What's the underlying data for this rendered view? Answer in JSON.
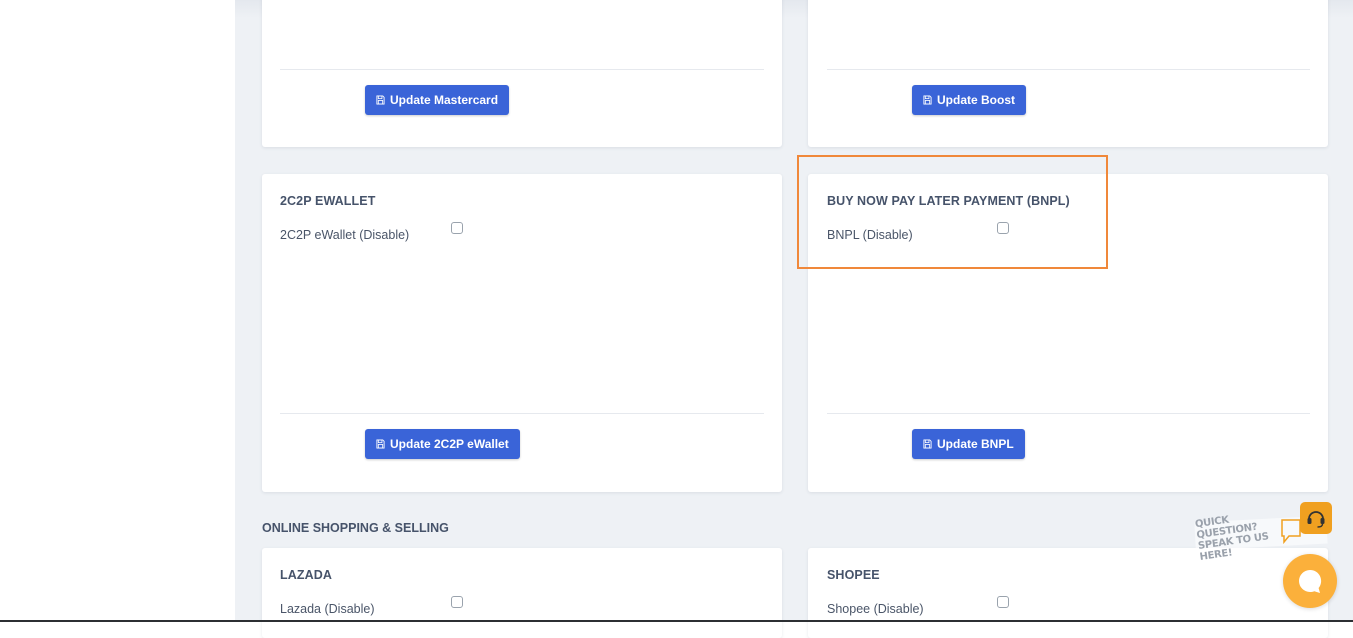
{
  "cards": {
    "mastercard": {
      "button_label": "Update Mastercard"
    },
    "boost": {
      "button_label": "Update Boost"
    },
    "ewallet": {
      "title": "2C2P EWALLET",
      "option_label": "2C2P eWallet (Disable)",
      "button_label": "Update 2C2P eWallet"
    },
    "bnpl": {
      "title": "BUY NOW PAY LATER PAYMENT (BNPL)",
      "option_label": "BNPL (Disable)",
      "button_label": "Update BNPL"
    },
    "lazada": {
      "title": "LAZADA",
      "option_label": "Lazada (Disable)"
    },
    "shopee": {
      "title": "SHOPEE",
      "option_label": "Shopee (Disable)"
    }
  },
  "sections": {
    "online_shopping": "ONLINE SHOPPING & SELLING"
  },
  "chat_widget": {
    "text_line1": "QUICK QUESTION?",
    "text_line2": "SPEAK TO US HERE!"
  },
  "colors": {
    "primary_button": "#3a64d8",
    "highlight": "#f0883a",
    "chat_bubble": "#fbb03b",
    "page_background": "#eef1f5"
  },
  "icons": {
    "button_icon": "save-icon",
    "chat_icon": "chat-bubble-icon",
    "support_icon": "headset-icon"
  }
}
